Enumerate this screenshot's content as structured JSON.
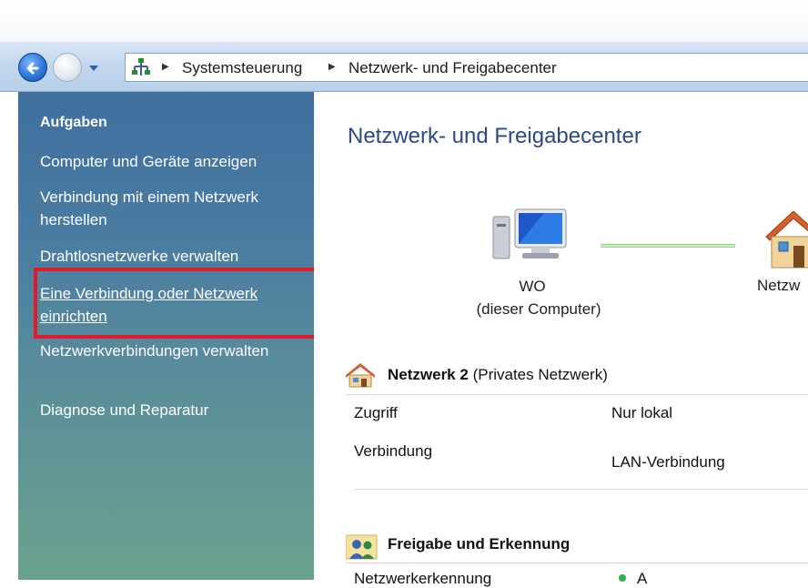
{
  "breadcrumb": {
    "items": [
      "Systemsteuerung",
      "Netzwerk- und Freigabecenter"
    ]
  },
  "sidebar": {
    "heading": "Aufgaben",
    "links": [
      "Computer und Geräte anzeigen",
      "Verbindung mit einem Netzwerk herstellen",
      "Drahtlosnetzwerke verwalten",
      "Eine Verbindung oder Netzwerk einrichten",
      "Netzwerkverbindungen verwalten",
      "Diagnose und Reparatur"
    ]
  },
  "main": {
    "title": "Netzwerk- und Freigabecenter",
    "computer_name": "WO",
    "computer_subtitle": "(dieser Computer)",
    "network_node_label": "Netzw",
    "network_section": {
      "name": "Netzwerk  2",
      "type": "(Privates Netzwerk)",
      "rows": [
        {
          "label": "Zugriff",
          "value": "Nur lokal"
        },
        {
          "label": "Verbindung",
          "value": "LAN-Verbindung"
        }
      ]
    },
    "sharing_section": {
      "title": "Freigabe und Erkennung",
      "partial_row_label": "Netzwerkerkennung",
      "partial_row_value": "A"
    }
  },
  "colors": {
    "highlight_border": "#e01a2a",
    "title_blue": "#2b4a86",
    "status_green": "#2fb24a"
  },
  "icons": [
    "back-arrow-icon",
    "forward-arrow-icon",
    "dropdown-arrow-icon",
    "network-tree-icon",
    "computer-icon",
    "house-icon",
    "users-icon"
  ]
}
